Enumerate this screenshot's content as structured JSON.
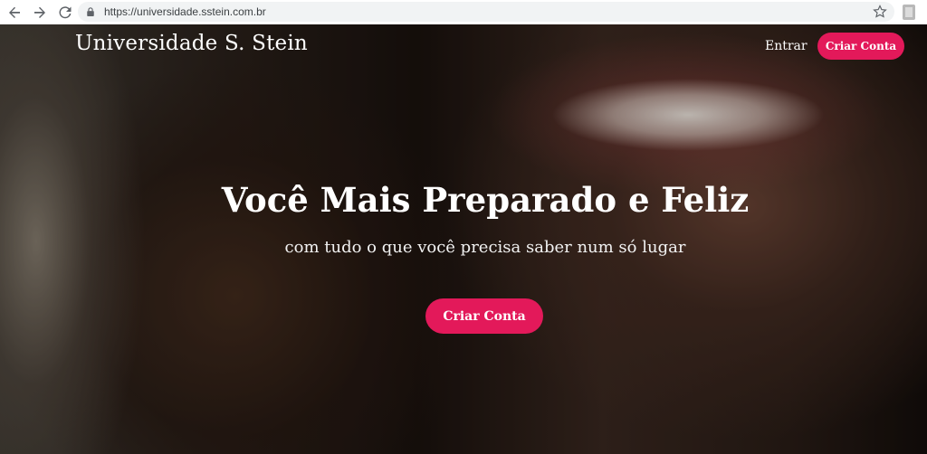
{
  "browser": {
    "url": "https://universidade.sstein.com.br",
    "icons": [
      "back-icon",
      "forward-icon",
      "reload-icon",
      "lock-icon",
      "star-icon",
      "extension-icon"
    ]
  },
  "header": {
    "brand": "Universidade S. Stein",
    "login_label": "Entrar",
    "signup_label": "Criar Conta"
  },
  "hero": {
    "title": "Você Mais Preparado e Feliz",
    "subtitle": "com tudo o que você precisa saber num só lugar",
    "cta_label": "Criar Conta"
  },
  "colors": {
    "accent": "#e3195a",
    "text": "#ffffff"
  }
}
